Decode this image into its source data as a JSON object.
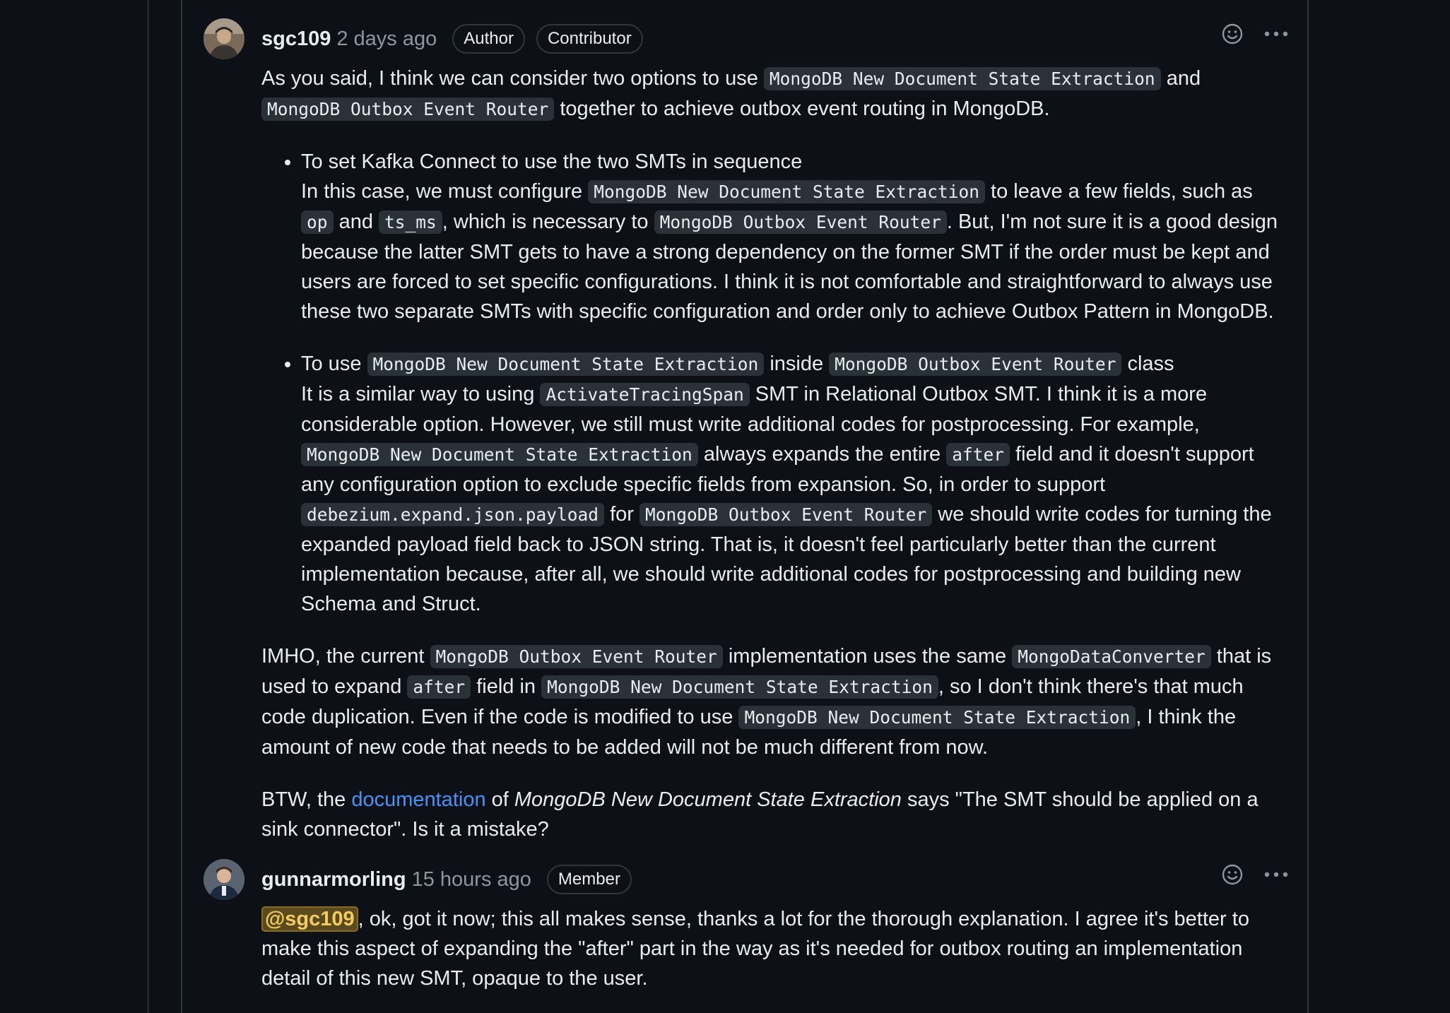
{
  "comments": [
    {
      "author": "sgc109",
      "timestamp": "2 days ago",
      "badges": [
        "Author",
        "Contributor"
      ],
      "body": {
        "p1": {
          "t1": "As you said, I think we can consider two options to use ",
          "c1": "MongoDB New Document State Extraction",
          "t2": " and ",
          "c2": "MongoDB Outbox Event Router",
          "t3": " together to achieve outbox event routing in MongoDB."
        },
        "bullet1": {
          "title": "To set Kafka Connect to use the two SMTs in sequence",
          "t1": "In this case, we must configure ",
          "c1": "MongoDB New Document State Extraction",
          "t2": " to leave a few fields, such as ",
          "c2": "op",
          "t3": " and ",
          "c3": "ts_ms",
          "t4": ", which is necessary to ",
          "c4": "MongoDB Outbox Event Router",
          "t5": ". But, I'm not sure it is a good design because the latter SMT gets to have a strong dependency on the former SMT if the order must be kept and users are forced to set specific configurations. I think it is not comfortable and straightforward to always use these two separate SMTs with specific configuration and order only to achieve Outbox Pattern in MongoDB."
        },
        "bullet2": {
          "t0": "To use ",
          "c0": "MongoDB New Document State Extraction",
          "t0b": " inside ",
          "c0b": "MongoDB Outbox Event Router",
          "t0c": " class",
          "t1": "It is a similar way to using ",
          "c1": "ActivateTracingSpan",
          "t2": " SMT in Relational Outbox SMT. I think it is a more considerable option. However, we still must write additional codes for postprocessing. For example, ",
          "c2": "MongoDB New Document State Extraction",
          "t3": " always expands the entire ",
          "c3": "after",
          "t4": " field and it doesn't support any configuration option to exclude specific fields from expansion. So, in order to support ",
          "c4": "debezium.expand.json.payload",
          "t5": " for ",
          "c5": "MongoDB Outbox Event Router",
          "t6": " we should write codes for turning the expanded payload field back to JSON string. That is, it doesn't feel particularly better than the current implementation because, after all, we should write additional codes for postprocessing and building new Schema and Struct."
        },
        "p2": {
          "t1": "IMHO, the current ",
          "c1": "MongoDB Outbox Event Router",
          "t2": " implementation uses the same ",
          "c2": "MongoDataConverter",
          "t3": " that is used to expand ",
          "c3": "after",
          "t4": " field in ",
          "c4": "MongoDB New Document State Extraction",
          "t5": ", so I don't think there's that much code duplication. Even if the code is modified to use ",
          "c5": "MongoDB New Document State Extraction",
          "t6": ", I think the amount of new code that needs to be added will not be much different from now."
        },
        "p3": {
          "t1": "BTW, the ",
          "link": "documentation",
          "t2": " of ",
          "em": "MongoDB New Document State Extraction",
          "t3": " says \"The SMT should be applied on a sink connector\". Is it a mistake?"
        }
      }
    },
    {
      "author": "gunnarmorling",
      "timestamp": "15 hours ago",
      "badges": [
        "Member"
      ],
      "body": {
        "mention": "@sgc109",
        "t1": ", ok, got it now; this all makes sense, thanks a lot for the thorough explanation. I agree it's better to make this aspect of expanding the \"after\" part in the way as it's needed for outbox routing an implementation detail of this new SMT, opaque to the user."
      }
    }
  ],
  "icons": {
    "reaction": "smiley-icon",
    "more": "kebab-horizontal-icon"
  },
  "colors": {
    "background": "#0d1117",
    "link": "#4493f8",
    "muted": "#8d96a0",
    "code_bg": "#2b3138",
    "mention_bg": "#5b4a1d",
    "mention_fg": "#f2cc60"
  }
}
